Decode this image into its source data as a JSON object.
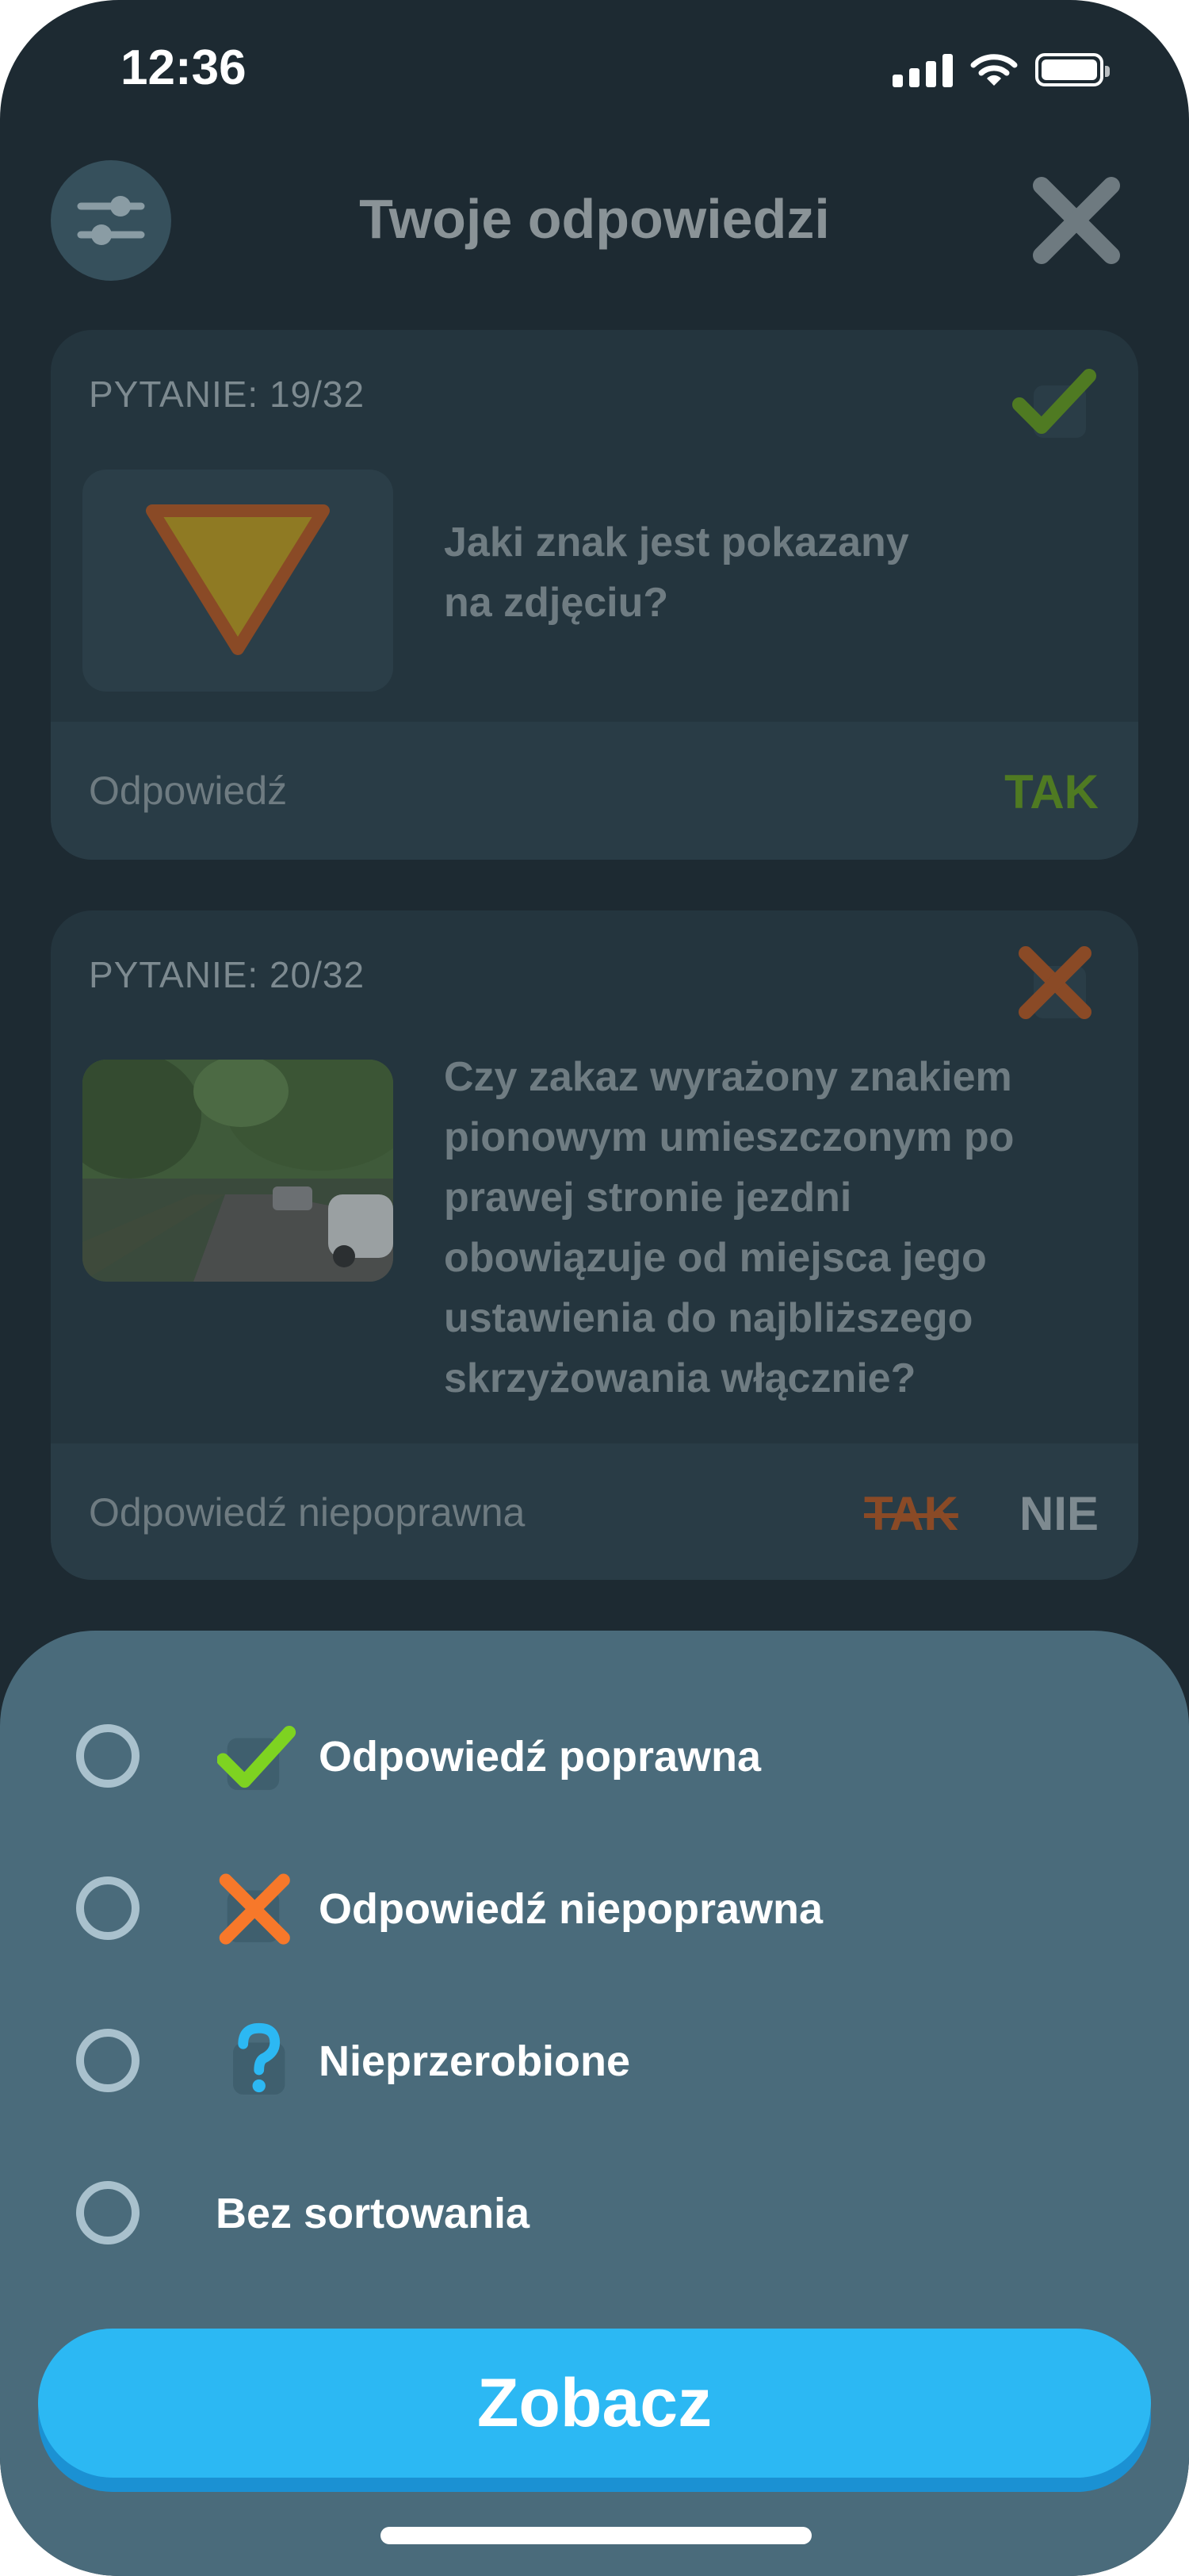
{
  "status_bar": {
    "time": "12:36"
  },
  "header": {
    "title": "Twoje odpowiedzi",
    "filter_icon": "sliders-icon",
    "close_icon": "close-icon"
  },
  "questions": [
    {
      "number_label": "PYTANIE: 19/32",
      "status": "correct",
      "status_icon": "check-icon",
      "image": "yield-sign-image",
      "text_lines": [
        "Jaki znak jest pokazany",
        "na zdjęciu?"
      ],
      "answer_label": "Odpowiedź",
      "answer_value": "TAK"
    },
    {
      "number_label": "PYTANIE: 20/32",
      "status": "incorrect",
      "status_icon": "cross-icon",
      "image": "street-photo-image",
      "text_lines": [
        "Czy zakaz wyrażony znakiem",
        "pionowym umieszczonym po",
        "prawej stronie jezdni",
        "obowiązuje od miejsca jego",
        "ustawienia do najbliższego",
        "skrzyżowania włącznie?"
      ],
      "answer_label": "Odpowiedź niepoprawna",
      "wrong_answer": "TAK",
      "correct_answer": "NIE"
    }
  ],
  "sort_sheet": {
    "options": [
      {
        "label": "Odpowiedź poprawna",
        "icon": "check-icon"
      },
      {
        "label": "Odpowiedź niepoprawna",
        "icon": "cross-icon"
      },
      {
        "label": "Nieprzerobione",
        "icon": "question-icon"
      },
      {
        "label": "Bez sortowania",
        "icon": ""
      }
    ],
    "button_label": "Zobacz"
  },
  "colors": {
    "background": "#1d2a32",
    "card": "#24353e",
    "sheet": "#4a6b7b",
    "accent": "#2cb8f3",
    "correct": "#7ed321",
    "incorrect": "#f7782a",
    "question": "#2cb8f3"
  }
}
